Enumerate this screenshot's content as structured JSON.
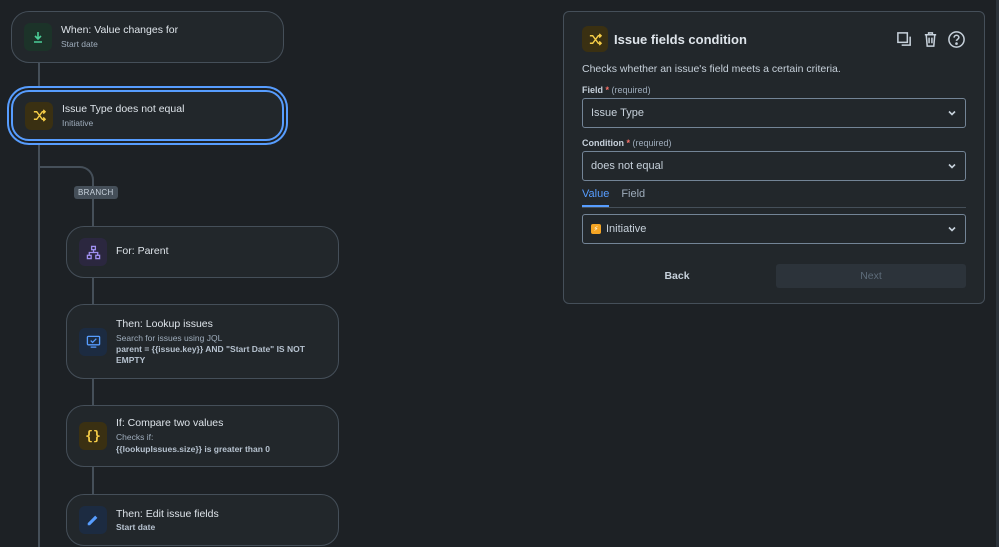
{
  "colors": {
    "background": "#1d2125",
    "node_bg": "#22272b",
    "selected_border": "#579dff",
    "green": "#4bce97",
    "yellow": "#f5cd47",
    "purple": "#9f8fef",
    "blue": "#579dff"
  },
  "flow": {
    "trigger": {
      "title": "When: Value changes for",
      "subtitle": "Start date",
      "icon": "download-icon"
    },
    "condition": {
      "title": "Issue Type does not equal",
      "subtitle": "Initiative",
      "icon": "shuffle-icon"
    },
    "branch_label": "BRANCH",
    "branch_for": {
      "title": "For: Parent",
      "icon": "hierarchy-icon"
    },
    "lookup": {
      "title": "Then: Lookup issues",
      "subtitle": "Search for issues using JQL",
      "code": "parent = {{issue.key}} AND \"Start Date\" IS NOT EMPTY",
      "icon": "monitor-icon"
    },
    "compare": {
      "title": "If: Compare two values",
      "subtitle": "Checks if:",
      "code": "{{lookupIssues.size}} is greater than 0",
      "icon": "braces-icon"
    },
    "edit": {
      "title": "Then: Edit issue fields",
      "subtitle": "Start date",
      "icon": "pencil-icon"
    }
  },
  "panel": {
    "title": "Issue fields condition",
    "icon": "shuffle-icon",
    "actions": [
      "copy-icon",
      "trash-icon",
      "help-icon"
    ],
    "description": "Checks whether an issue's field meets a certain criteria.",
    "field_label": "Field",
    "field_hint": "(required)",
    "field_value": "Issue Type",
    "condition_label": "Condition",
    "condition_hint": "(required)",
    "condition_value": "does not equal",
    "tabs": [
      "Value",
      "Field"
    ],
    "active_tab": "Value",
    "value": "Initiative",
    "back_label": "Back",
    "next_label": "Next"
  }
}
